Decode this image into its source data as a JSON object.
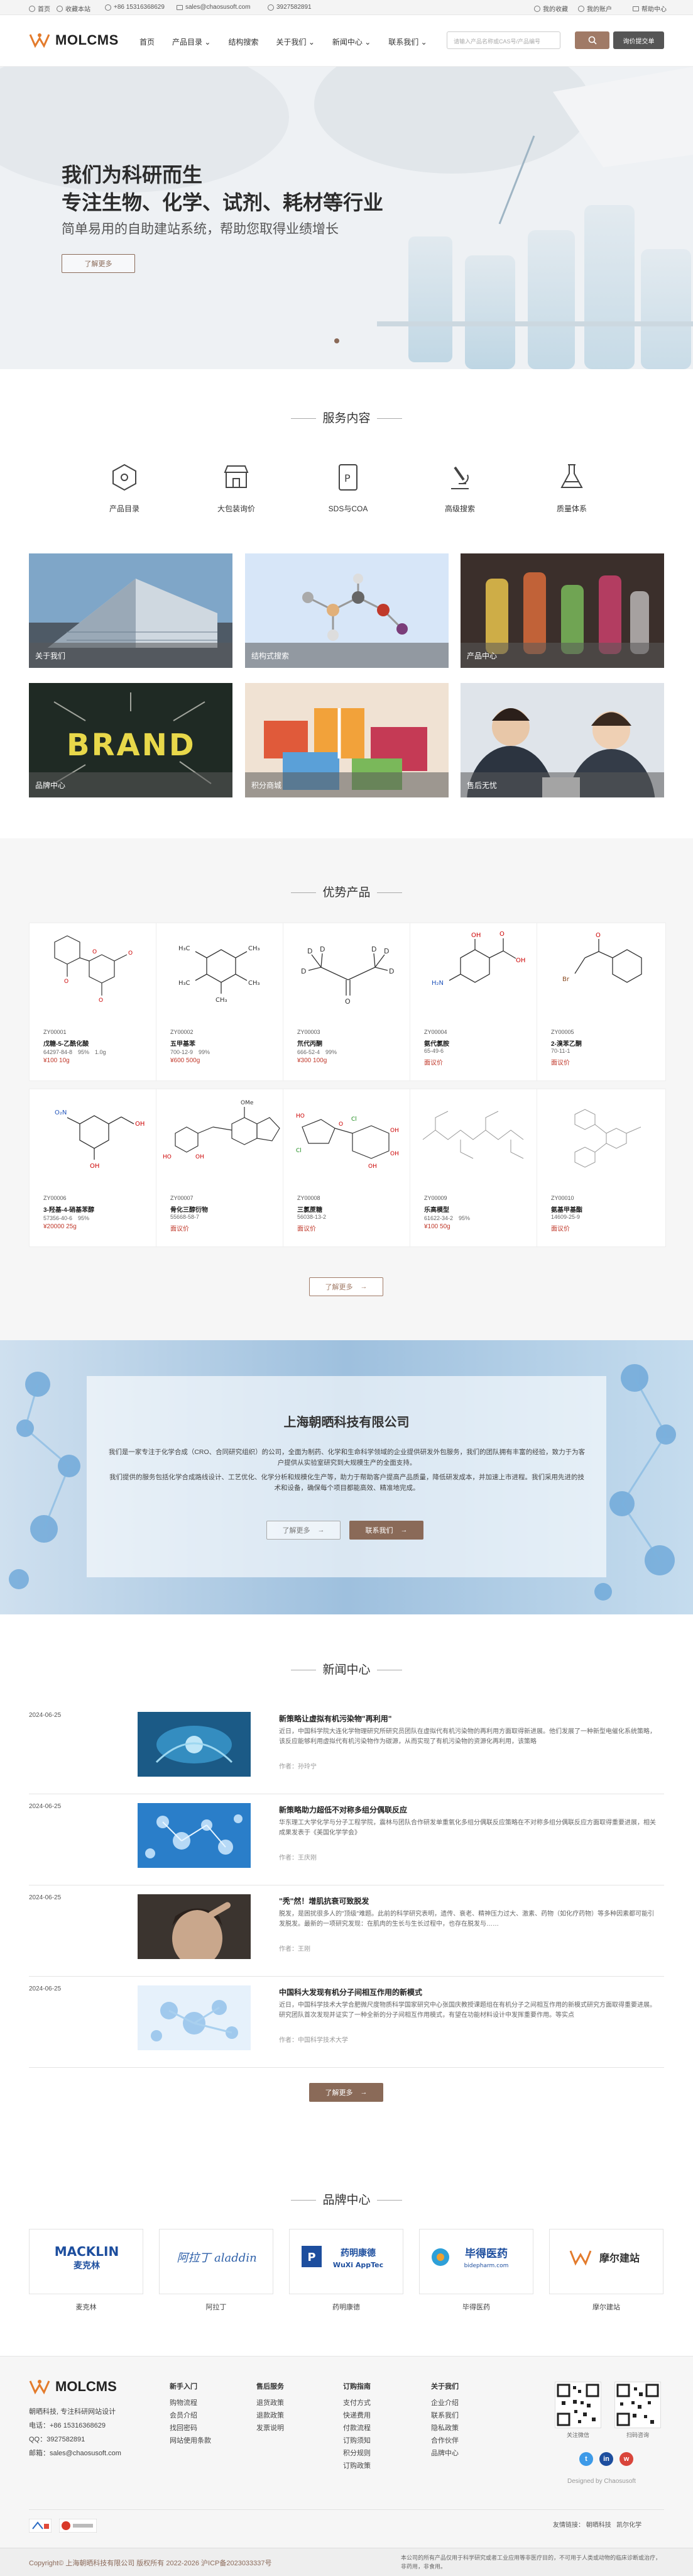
{
  "topbar": {
    "home": "首页",
    "favorite": "收藏本站",
    "phone": "+86 15316368629",
    "email": "sales@chaosusoft.com",
    "qq": "3927582891",
    "my_favorites": "我的收藏",
    "my_account": "我的账户",
    "help": "帮助中心"
  },
  "nav": {
    "logo_text": "MOLCMS",
    "menu": [
      "首页",
      "产品目录",
      "结构搜索",
      "关于我们",
      "新闻中心",
      "联系我们"
    ],
    "search_placeholder": "请输入产品名称或CAS号/产品编号",
    "request_button": "询价提交单"
  },
  "hero": {
    "title_line1": "我们为科研而生",
    "title_line2": "专注生物、化学、试剂、耗材等行业",
    "subtitle": "简单易用的自助建站系统，帮助您取得业绩增长",
    "more": "了解更多"
  },
  "services": {
    "title": "服务内容",
    "items": [
      "产品目录",
      "大包装询价",
      "SDS与COA",
      "高级搜索",
      "质量体系"
    ]
  },
  "tiles": [
    "关于我们",
    "结构式搜索",
    "产品中心",
    "品牌中心",
    "积分商城",
    "售后无忧"
  ],
  "products": {
    "title": "优势产品",
    "more": "了解更多",
    "items": [
      {
        "code": "ZY00001",
        "name": "戊糖-5-乙酰化酸",
        "spec": "64297-84-8　95%　1.0g",
        "price": "¥100 10g"
      },
      {
        "code": "ZY00002",
        "name": "五甲基苯",
        "spec": "700-12-9　99%",
        "price": "¥600 500g"
      },
      {
        "code": "ZY00003",
        "name": "氘代丙酮",
        "spec": "666-52-4　99%",
        "price": "¥300 100g"
      },
      {
        "code": "ZY00004",
        "name": "氨代氯胺",
        "spec": "65-49-6",
        "price": "面议价"
      },
      {
        "code": "ZY00005",
        "name": "2-溴苯乙酮",
        "spec": "70-11-1",
        "price": "面议价"
      },
      {
        "code": "ZY00006",
        "name": "3-羟基-4-硝基苯醇",
        "spec": "57356-40-6　95%",
        "price": "¥20000 25g"
      },
      {
        "code": "ZY00007",
        "name": "骨化三醇衍物",
        "spec": "55668-58-7",
        "price": "面议价"
      },
      {
        "code": "ZY00008",
        "name": "三氯蔗糖",
        "spec": "56038-13-2",
        "price": "面议价"
      },
      {
        "code": "ZY00009",
        "name": "乐高模型",
        "spec": "61622-34-2　95%",
        "price": "¥100 50g"
      },
      {
        "code": "ZY00010",
        "name": "氨基甲基酯",
        "spec": "14609-25-9",
        "price": "面议价"
      }
    ]
  },
  "about": {
    "title": "上海朝晒科技有限公司",
    "p1": "我们是一家专注于化学合成（CRO、合同研究组织）的公司，全面为制药、化学和生命科学领域的企业提供研发外包服务，我们的团队拥有丰富的经验，致力于为客户提供从实验室研究到大规模生产的全面支持。",
    "p2": "我们提供的服务包括化学合成路线设计、工艺优化、化学分析和规模化生产等，助力于帮助客户提高产品质量，降低研发成本，并加速上市进程。我们采用先进的技术和设备，确保每个项目都能高效、精准地完成。",
    "more": "了解更多",
    "contact": "联系我们"
  },
  "news": {
    "title": "新闻中心",
    "more": "了解更多",
    "items": [
      {
        "date": "2024-06-25",
        "title": "新策略让虚拟有机污染物\"再利用\"",
        "desc": "近日，中国科学院大连化学物理研究所研究员团队在虚拟代有机污染物的再利用方面取得新进展。他们发展了一种新型电催化系统策略，该反应能够利用虚拟代有机污染物作为碳源，从而实现了有机污染物的资源化再利用，该策略",
        "author": "作者：孙玲宁"
      },
      {
        "date": "2024-06-25",
        "title": "新策略助力超低不对称多组分偶联反应",
        "desc": "华东理工大学化学与分子工程学院，震林与团队合作研发单重氧化多组分偶联反应策略在不对称多组分偶联反应方面取得重要进展，相关成果发表于《美国化学学会》",
        "author": "作者：王庆刚"
      },
      {
        "date": "2024-06-25",
        "title": "\"秃\"然！增肌抗衰可致脱发",
        "desc": "脱发，是困扰很多人的\"顶级\"难题。此前的科学研究表明，遗传、衰老、精神压力过大、激素、药物（如化疗药物）等多种因素都可能引发脱发。最新的一项研究发现：在肌肉的生长与生长过程中，也存在脱发与……",
        "author": "作者：王刚"
      },
      {
        "date": "2024-06-25",
        "title": "中国科大发现有机分子间相互作用的新模式",
        "desc": "近日，中国科学技术大学合肥微尺度物质科学国家研究中心张国庆教授课题组在有机分子之间相互作用的新模式研究方面取得重要进展。研究团队首次发现并证实了一种全新的分子间相互作用模式，有望在功能材料设计中发挥重要作用。等实点",
        "author": "作者：中国科学技术大学"
      }
    ]
  },
  "brands": {
    "title": "品牌中心",
    "items": [
      {
        "logo": "MACKLIN 麦克林",
        "name": "麦克林"
      },
      {
        "logo": "阿拉丁 aladdin",
        "name": "阿拉丁"
      },
      {
        "logo": "药明康德 WuXi AppTec",
        "name": "药明康德"
      },
      {
        "logo": "毕得医药 bidepharm.com",
        "name": "毕得医药"
      },
      {
        "logo": "摩尔建站",
        "name": "摩尔建站"
      }
    ]
  },
  "footer": {
    "logo_text": "MOLCMS",
    "company": "朝晒科技, 专注科研网站设计",
    "phone": "电话：+86 15316368629",
    "qq": "QQ：3927582891",
    "email": "邮箱：sales@chaosusoft.com",
    "cols": [
      {
        "h": "新手入门",
        "items": [
          "购物流程",
          "会员介绍",
          "找回密码",
          "网站使用条款"
        ]
      },
      {
        "h": "售后服务",
        "items": [
          "退货政策",
          "退款政策",
          "发票说明"
        ]
      },
      {
        "h": "订购指南",
        "items": [
          "支付方式",
          "快递费用",
          "付款流程",
          "订购须知",
          "积分规则",
          "订购政策"
        ]
      },
      {
        "h": "关于我们",
        "items": [
          "企业介绍",
          "联系我们",
          "隐私政策",
          "合作伙伴",
          "品牌中心"
        ]
      }
    ],
    "qr1": "关注微信",
    "qr2": "扫码咨询",
    "designed_by": "Designed by Chaosusoft",
    "friend_links_label": "友情链接：",
    "friend_links": [
      "朝晒科技",
      "凯尔化学"
    ],
    "badge1": "",
    "badge2": "",
    "disclaimer": "本公司的所有产品仅用于科学研究或者工业应用等非医疗目的，不可用于人类或动物的临床诊断或治疗，非药用，非食用。",
    "copyright": "Copyright© 上海朝晒科技有限公司 版权所有 2022-2026 沪ICP备2023033337号"
  },
  "colors": {
    "accent": "#a07a66",
    "dark": "#555555",
    "price": "#c0392b",
    "brand_orange": "#e37b2c"
  }
}
